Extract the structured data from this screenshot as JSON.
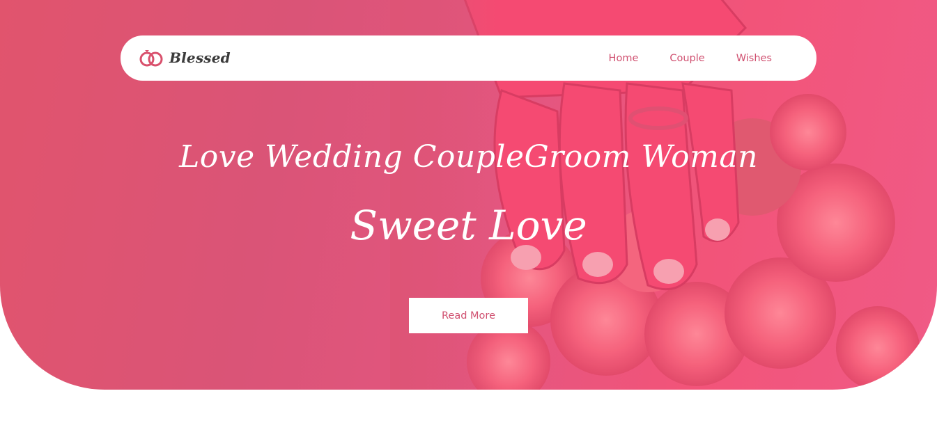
{
  "brand": {
    "name": "Blessed",
    "icon": "wedding-rings-icon"
  },
  "nav": {
    "items": [
      "Home",
      "Couple",
      "Wishes"
    ]
  },
  "hero": {
    "title": "Love Wedding CoupleGroom Woman",
    "subtitle": "Sweet Love",
    "cta_label": "Read More"
  },
  "colors": {
    "accent": "#d05070",
    "hero_pink": "#e55679",
    "white": "#ffffff"
  }
}
